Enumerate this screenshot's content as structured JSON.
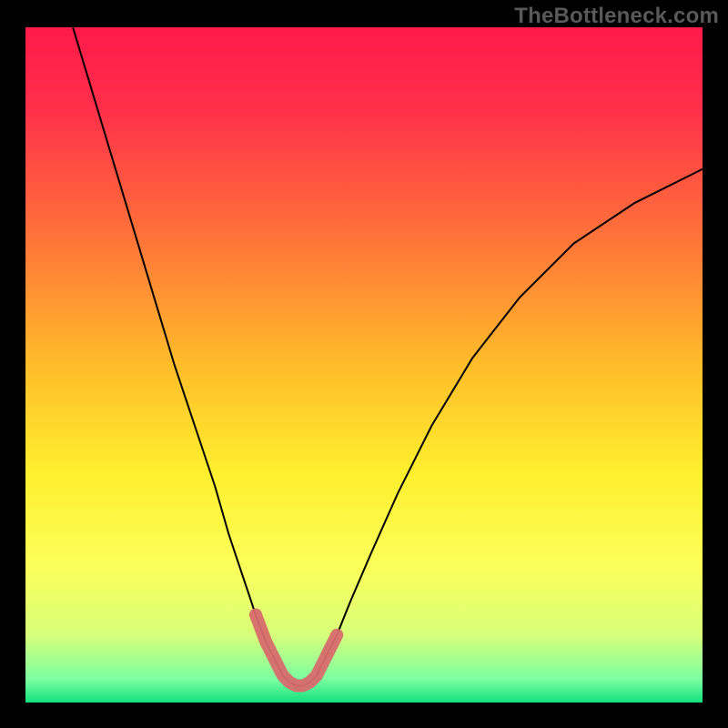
{
  "watermark": "TheBottleneck.com",
  "chart_data": {
    "type": "line",
    "title": "",
    "xlabel": "",
    "ylabel": "",
    "xlim": [
      0,
      100
    ],
    "ylim": [
      0,
      100
    ],
    "series": [
      {
        "name": "bottleneck-curve",
        "x": [
          7,
          10,
          13,
          16,
          19,
          22,
          25,
          28,
          30,
          32,
          34,
          35.5,
          37,
          38,
          39,
          40,
          41,
          42,
          43,
          44,
          46,
          48,
          51,
          55,
          60,
          66,
          73,
          81,
          90,
          100
        ],
        "values": [
          100,
          90,
          80,
          70,
          60,
          50,
          41,
          32,
          25,
          19,
          13,
          9,
          6,
          4,
          3,
          2.5,
          2.5,
          3,
          4,
          6,
          10,
          15,
          22,
          31,
          41,
          51,
          60,
          68,
          74,
          79
        ]
      }
    ],
    "highlight": {
      "name": "optimal-zone",
      "x_start": 34,
      "x_end": 46,
      "color": "#d86b6e"
    },
    "gradient_stops": [
      {
        "offset": 0.0,
        "color": "#ff1a4a"
      },
      {
        "offset": 0.12,
        "color": "#ff2f4a"
      },
      {
        "offset": 0.3,
        "color": "#ff6f3a"
      },
      {
        "offset": 0.5,
        "color": "#ffbc2a"
      },
      {
        "offset": 0.66,
        "color": "#ffef2e"
      },
      {
        "offset": 0.8,
        "color": "#fbff5a"
      },
      {
        "offset": 0.9,
        "color": "#d7ff7a"
      },
      {
        "offset": 0.965,
        "color": "#7cffa0"
      },
      {
        "offset": 1.0,
        "color": "#13e07f"
      }
    ]
  }
}
